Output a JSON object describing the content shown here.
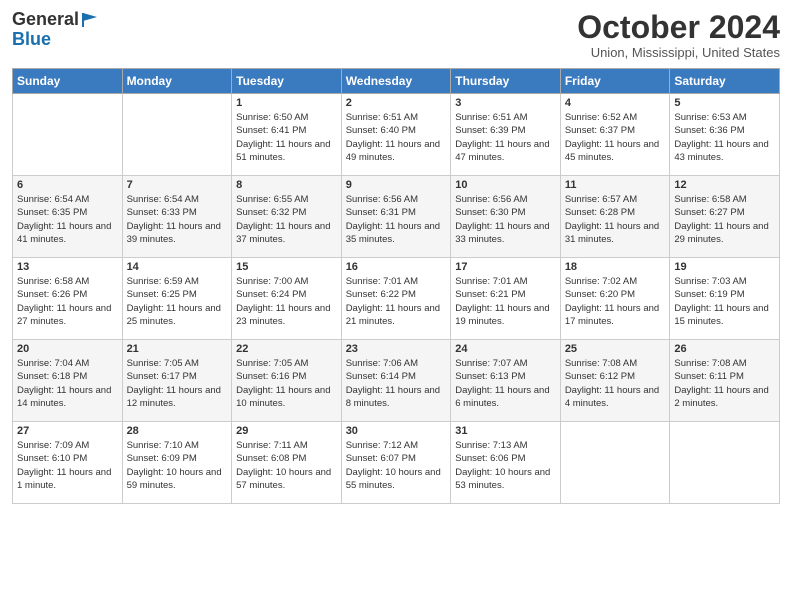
{
  "header": {
    "logo_general": "General",
    "logo_blue": "Blue",
    "month": "October 2024",
    "location": "Union, Mississippi, United States"
  },
  "weekdays": [
    "Sunday",
    "Monday",
    "Tuesday",
    "Wednesday",
    "Thursday",
    "Friday",
    "Saturday"
  ],
  "weeks": [
    [
      {
        "day": "",
        "info": ""
      },
      {
        "day": "",
        "info": ""
      },
      {
        "day": "1",
        "info": "Sunrise: 6:50 AM\nSunset: 6:41 PM\nDaylight: 11 hours and 51 minutes."
      },
      {
        "day": "2",
        "info": "Sunrise: 6:51 AM\nSunset: 6:40 PM\nDaylight: 11 hours and 49 minutes."
      },
      {
        "day": "3",
        "info": "Sunrise: 6:51 AM\nSunset: 6:39 PM\nDaylight: 11 hours and 47 minutes."
      },
      {
        "day": "4",
        "info": "Sunrise: 6:52 AM\nSunset: 6:37 PM\nDaylight: 11 hours and 45 minutes."
      },
      {
        "day": "5",
        "info": "Sunrise: 6:53 AM\nSunset: 6:36 PM\nDaylight: 11 hours and 43 minutes."
      }
    ],
    [
      {
        "day": "6",
        "info": "Sunrise: 6:54 AM\nSunset: 6:35 PM\nDaylight: 11 hours and 41 minutes."
      },
      {
        "day": "7",
        "info": "Sunrise: 6:54 AM\nSunset: 6:33 PM\nDaylight: 11 hours and 39 minutes."
      },
      {
        "day": "8",
        "info": "Sunrise: 6:55 AM\nSunset: 6:32 PM\nDaylight: 11 hours and 37 minutes."
      },
      {
        "day": "9",
        "info": "Sunrise: 6:56 AM\nSunset: 6:31 PM\nDaylight: 11 hours and 35 minutes."
      },
      {
        "day": "10",
        "info": "Sunrise: 6:56 AM\nSunset: 6:30 PM\nDaylight: 11 hours and 33 minutes."
      },
      {
        "day": "11",
        "info": "Sunrise: 6:57 AM\nSunset: 6:28 PM\nDaylight: 11 hours and 31 minutes."
      },
      {
        "day": "12",
        "info": "Sunrise: 6:58 AM\nSunset: 6:27 PM\nDaylight: 11 hours and 29 minutes."
      }
    ],
    [
      {
        "day": "13",
        "info": "Sunrise: 6:58 AM\nSunset: 6:26 PM\nDaylight: 11 hours and 27 minutes."
      },
      {
        "day": "14",
        "info": "Sunrise: 6:59 AM\nSunset: 6:25 PM\nDaylight: 11 hours and 25 minutes."
      },
      {
        "day": "15",
        "info": "Sunrise: 7:00 AM\nSunset: 6:24 PM\nDaylight: 11 hours and 23 minutes."
      },
      {
        "day": "16",
        "info": "Sunrise: 7:01 AM\nSunset: 6:22 PM\nDaylight: 11 hours and 21 minutes."
      },
      {
        "day": "17",
        "info": "Sunrise: 7:01 AM\nSunset: 6:21 PM\nDaylight: 11 hours and 19 minutes."
      },
      {
        "day": "18",
        "info": "Sunrise: 7:02 AM\nSunset: 6:20 PM\nDaylight: 11 hours and 17 minutes."
      },
      {
        "day": "19",
        "info": "Sunrise: 7:03 AM\nSunset: 6:19 PM\nDaylight: 11 hours and 15 minutes."
      }
    ],
    [
      {
        "day": "20",
        "info": "Sunrise: 7:04 AM\nSunset: 6:18 PM\nDaylight: 11 hours and 14 minutes."
      },
      {
        "day": "21",
        "info": "Sunrise: 7:05 AM\nSunset: 6:17 PM\nDaylight: 11 hours and 12 minutes."
      },
      {
        "day": "22",
        "info": "Sunrise: 7:05 AM\nSunset: 6:16 PM\nDaylight: 11 hours and 10 minutes."
      },
      {
        "day": "23",
        "info": "Sunrise: 7:06 AM\nSunset: 6:14 PM\nDaylight: 11 hours and 8 minutes."
      },
      {
        "day": "24",
        "info": "Sunrise: 7:07 AM\nSunset: 6:13 PM\nDaylight: 11 hours and 6 minutes."
      },
      {
        "day": "25",
        "info": "Sunrise: 7:08 AM\nSunset: 6:12 PM\nDaylight: 11 hours and 4 minutes."
      },
      {
        "day": "26",
        "info": "Sunrise: 7:08 AM\nSunset: 6:11 PM\nDaylight: 11 hours and 2 minutes."
      }
    ],
    [
      {
        "day": "27",
        "info": "Sunrise: 7:09 AM\nSunset: 6:10 PM\nDaylight: 11 hours and 1 minute."
      },
      {
        "day": "28",
        "info": "Sunrise: 7:10 AM\nSunset: 6:09 PM\nDaylight: 10 hours and 59 minutes."
      },
      {
        "day": "29",
        "info": "Sunrise: 7:11 AM\nSunset: 6:08 PM\nDaylight: 10 hours and 57 minutes."
      },
      {
        "day": "30",
        "info": "Sunrise: 7:12 AM\nSunset: 6:07 PM\nDaylight: 10 hours and 55 minutes."
      },
      {
        "day": "31",
        "info": "Sunrise: 7:13 AM\nSunset: 6:06 PM\nDaylight: 10 hours and 53 minutes."
      },
      {
        "day": "",
        "info": ""
      },
      {
        "day": "",
        "info": ""
      }
    ]
  ]
}
